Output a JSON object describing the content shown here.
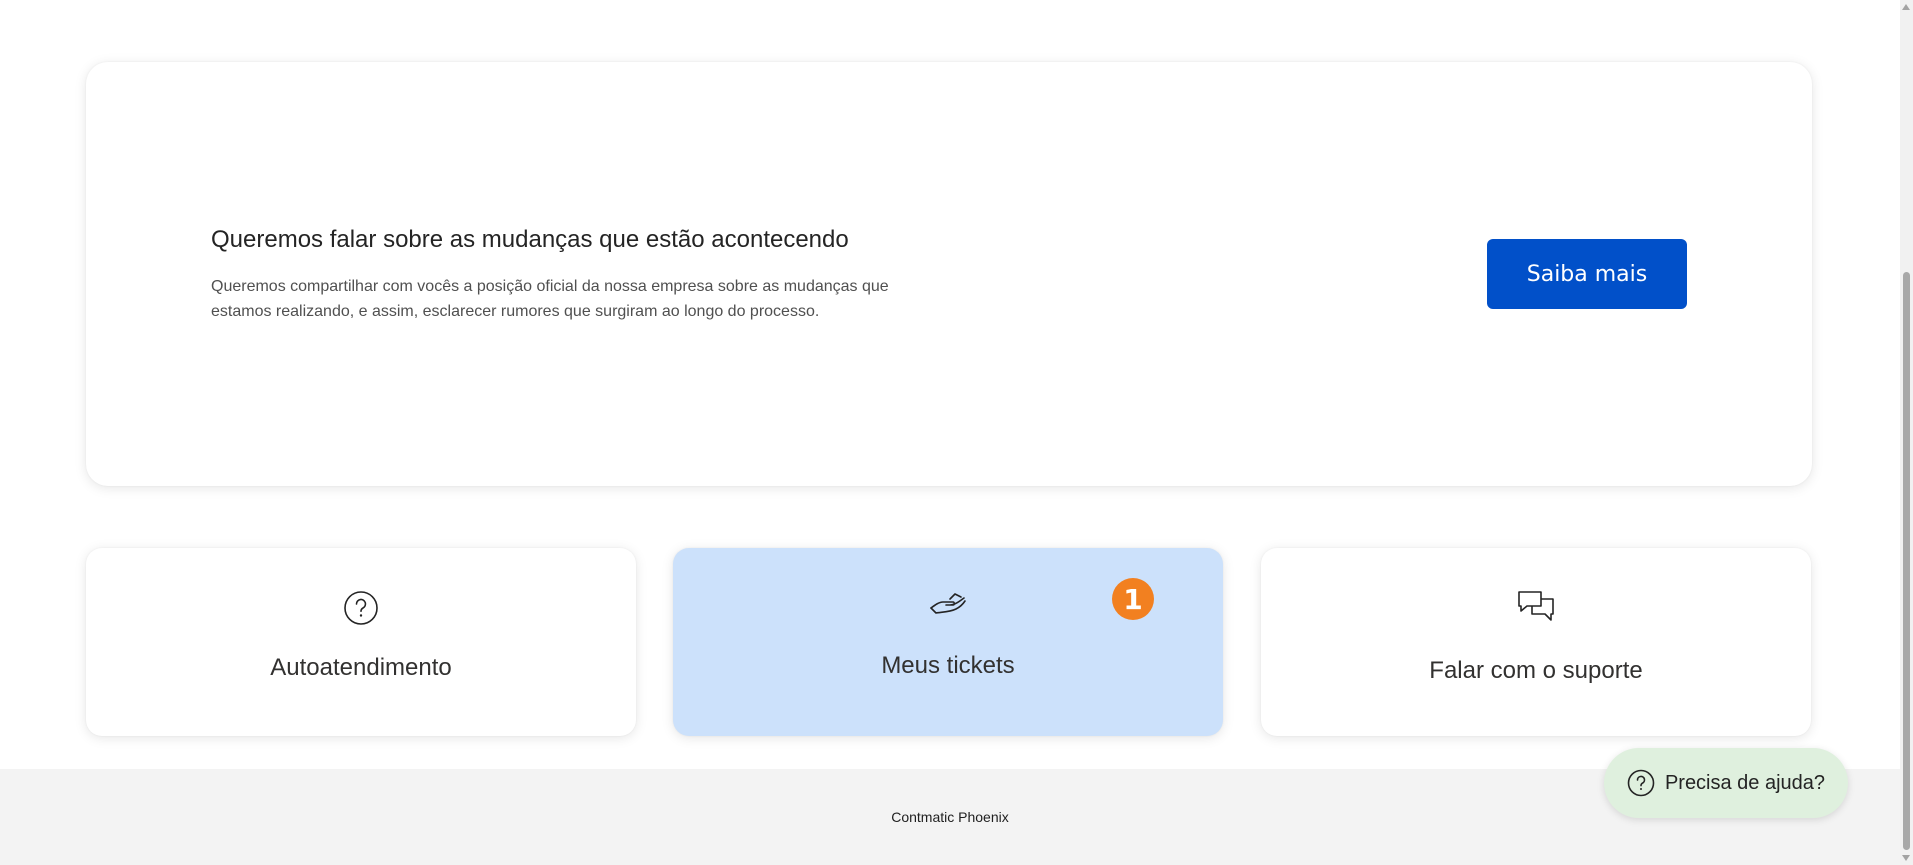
{
  "announcement": {
    "title": "Queremos falar sobre as mudanças que estão acontecendo",
    "description": "Queremos compartilhar com vocês a posição oficial da nossa empresa sobre as mudanças que estamos realizando, e assim, esclarecer rumores que surgiram ao longo do processo.",
    "button_label": "Saiba mais",
    "button_color": "#0150c9"
  },
  "cards": [
    {
      "label": "Autoatendimento",
      "icon": "question-circle-icon",
      "active": false
    },
    {
      "label": "Meus tickets",
      "icon": "hand-ticket-icon",
      "active": true,
      "badge": "1"
    },
    {
      "label": "Falar com o suporte",
      "icon": "chat-bubbles-icon",
      "active": false
    }
  ],
  "footer": {
    "text": "Contmatic Phoenix"
  },
  "help": {
    "label": "Precisa de ajuda?",
    "icon": "question-circle-icon"
  },
  "colors": {
    "active_card": "#cce1fb",
    "badge": "#f28020",
    "help_button": "#dff0de",
    "footer_bg": "#f3f3f3"
  }
}
